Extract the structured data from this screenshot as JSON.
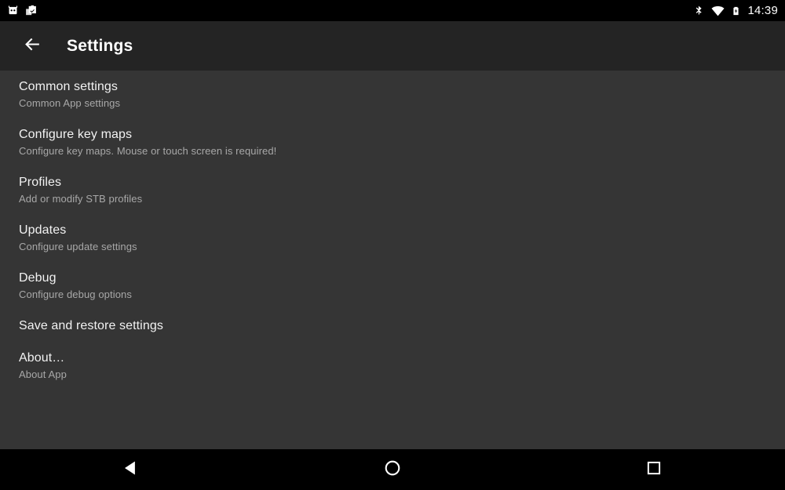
{
  "status_bar": {
    "notification_icons": [
      "app-notification-icon",
      "clipboard-check-icon"
    ],
    "system_icons": [
      "bluetooth-icon",
      "wifi-icon",
      "battery-charging-icon"
    ],
    "clock": "14:39",
    "background_color": "#000000",
    "foreground_color": "#ffffff"
  },
  "toolbar": {
    "back_icon": "back-arrow-icon",
    "title": "Settings",
    "background_color": "#242424",
    "title_color": "#ffffff"
  },
  "content": {
    "background_color": "#353535",
    "title_color": "#f2f2f2",
    "subtitle_color": "#a8a8a8",
    "items": [
      {
        "title": "Common settings",
        "subtitle": "Common App settings"
      },
      {
        "title": "Configure key maps",
        "subtitle": "Configure key maps. Mouse or touch screen is required!"
      },
      {
        "title": "Profiles",
        "subtitle": "Add or modify STB profiles"
      },
      {
        "title": "Updates",
        "subtitle": "Configure update settings"
      },
      {
        "title": "Debug",
        "subtitle": "Configure debug options"
      },
      {
        "title": "Save and restore settings",
        "subtitle": ""
      },
      {
        "title": "About…",
        "subtitle": "About App"
      }
    ]
  },
  "nav_bar": {
    "background_color": "#000000",
    "buttons": [
      {
        "name": "back",
        "icon": "nav-back-triangle-icon"
      },
      {
        "name": "home",
        "icon": "nav-home-circle-icon"
      },
      {
        "name": "recents",
        "icon": "nav-recents-square-icon"
      }
    ]
  }
}
